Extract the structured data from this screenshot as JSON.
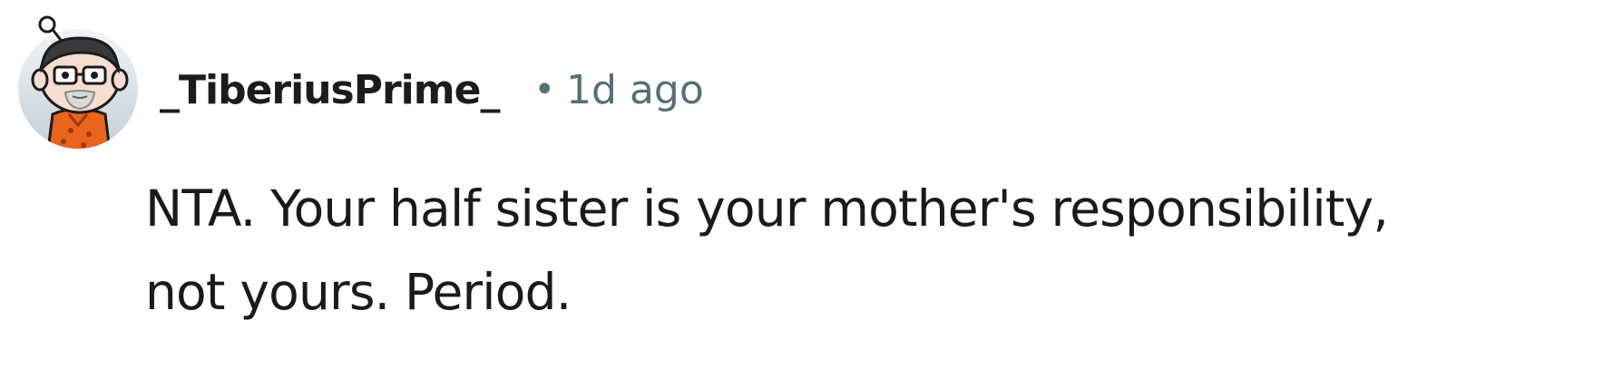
{
  "comment": {
    "avatar_icon": "user-avatar-icon",
    "username": "_TiberiusPrime_",
    "separator": "•",
    "timestamp": "1d ago",
    "body_lines": [
      "NTA. Your half sister is your mother's responsibility,",
      "not yours. Period."
    ]
  },
  "colors": {
    "text": "#1a1a1b",
    "meta": "#576f76",
    "avatar_bg": "#d5dde2",
    "shirt": "#e8641f"
  }
}
